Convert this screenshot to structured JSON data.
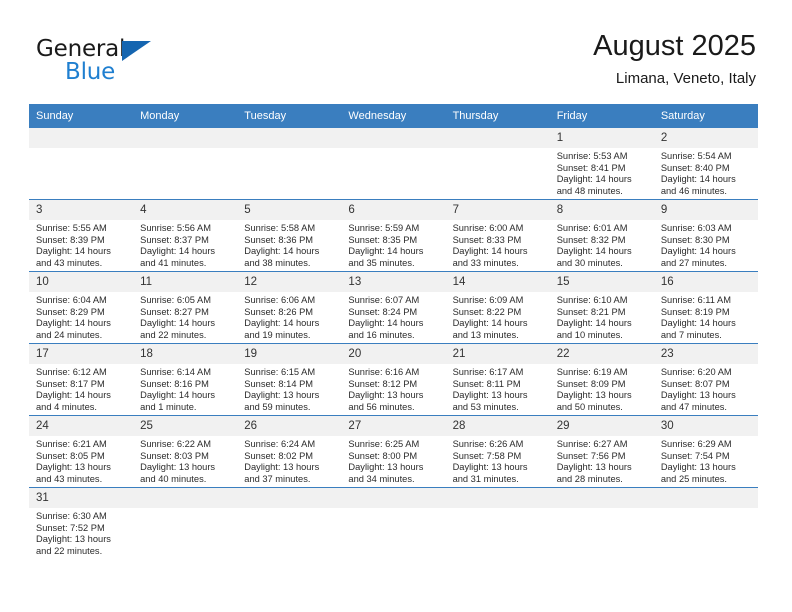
{
  "brand": {
    "name_top": "General",
    "name_bottom": "Blue",
    "triangle_icon": "triangle-icon",
    "color_dark": "#1a1a1a",
    "color_blue": "#1f7fd0"
  },
  "header": {
    "title": "August 2025",
    "subtitle": "Limana, Veneto, Italy"
  },
  "theme": {
    "header_blue": "#3a7ebf",
    "daynum_band": "#f1f1f1",
    "grid_line": "#3a7ebf",
    "text": "#2b2b2b"
  },
  "weekdays": [
    "Sunday",
    "Monday",
    "Tuesday",
    "Wednesday",
    "Thursday",
    "Friday",
    "Saturday"
  ],
  "weeks": [
    [
      {
        "day": "",
        "blank": true,
        "sunrise": "",
        "sunset": "",
        "daylight_1": "",
        "daylight_2": ""
      },
      {
        "day": "",
        "blank": true,
        "sunrise": "",
        "sunset": "",
        "daylight_1": "",
        "daylight_2": ""
      },
      {
        "day": "",
        "blank": true,
        "sunrise": "",
        "sunset": "",
        "daylight_1": "",
        "daylight_2": ""
      },
      {
        "day": "",
        "blank": true,
        "sunrise": "",
        "sunset": "",
        "daylight_1": "",
        "daylight_2": ""
      },
      {
        "day": "",
        "blank": true,
        "sunrise": "",
        "sunset": "",
        "daylight_1": "",
        "daylight_2": ""
      },
      {
        "day": "1",
        "blank": false,
        "sunrise": "Sunrise: 5:53 AM",
        "sunset": "Sunset: 8:41 PM",
        "daylight_1": "Daylight: 14 hours",
        "daylight_2": "and 48 minutes."
      },
      {
        "day": "2",
        "blank": false,
        "sunrise": "Sunrise: 5:54 AM",
        "sunset": "Sunset: 8:40 PM",
        "daylight_1": "Daylight: 14 hours",
        "daylight_2": "and 46 minutes."
      }
    ],
    [
      {
        "day": "3",
        "blank": false,
        "sunrise": "Sunrise: 5:55 AM",
        "sunset": "Sunset: 8:39 PM",
        "daylight_1": "Daylight: 14 hours",
        "daylight_2": "and 43 minutes."
      },
      {
        "day": "4",
        "blank": false,
        "sunrise": "Sunrise: 5:56 AM",
        "sunset": "Sunset: 8:37 PM",
        "daylight_1": "Daylight: 14 hours",
        "daylight_2": "and 41 minutes."
      },
      {
        "day": "5",
        "blank": false,
        "sunrise": "Sunrise: 5:58 AM",
        "sunset": "Sunset: 8:36 PM",
        "daylight_1": "Daylight: 14 hours",
        "daylight_2": "and 38 minutes."
      },
      {
        "day": "6",
        "blank": false,
        "sunrise": "Sunrise: 5:59 AM",
        "sunset": "Sunset: 8:35 PM",
        "daylight_1": "Daylight: 14 hours",
        "daylight_2": "and 35 minutes."
      },
      {
        "day": "7",
        "blank": false,
        "sunrise": "Sunrise: 6:00 AM",
        "sunset": "Sunset: 8:33 PM",
        "daylight_1": "Daylight: 14 hours",
        "daylight_2": "and 33 minutes."
      },
      {
        "day": "8",
        "blank": false,
        "sunrise": "Sunrise: 6:01 AM",
        "sunset": "Sunset: 8:32 PM",
        "daylight_1": "Daylight: 14 hours",
        "daylight_2": "and 30 minutes."
      },
      {
        "day": "9",
        "blank": false,
        "sunrise": "Sunrise: 6:03 AM",
        "sunset": "Sunset: 8:30 PM",
        "daylight_1": "Daylight: 14 hours",
        "daylight_2": "and 27 minutes."
      }
    ],
    [
      {
        "day": "10",
        "blank": false,
        "sunrise": "Sunrise: 6:04 AM",
        "sunset": "Sunset: 8:29 PM",
        "daylight_1": "Daylight: 14 hours",
        "daylight_2": "and 24 minutes."
      },
      {
        "day": "11",
        "blank": false,
        "sunrise": "Sunrise: 6:05 AM",
        "sunset": "Sunset: 8:27 PM",
        "daylight_1": "Daylight: 14 hours",
        "daylight_2": "and 22 minutes."
      },
      {
        "day": "12",
        "blank": false,
        "sunrise": "Sunrise: 6:06 AM",
        "sunset": "Sunset: 8:26 PM",
        "daylight_1": "Daylight: 14 hours",
        "daylight_2": "and 19 minutes."
      },
      {
        "day": "13",
        "blank": false,
        "sunrise": "Sunrise: 6:07 AM",
        "sunset": "Sunset: 8:24 PM",
        "daylight_1": "Daylight: 14 hours",
        "daylight_2": "and 16 minutes."
      },
      {
        "day": "14",
        "blank": false,
        "sunrise": "Sunrise: 6:09 AM",
        "sunset": "Sunset: 8:22 PM",
        "daylight_1": "Daylight: 14 hours",
        "daylight_2": "and 13 minutes."
      },
      {
        "day": "15",
        "blank": false,
        "sunrise": "Sunrise: 6:10 AM",
        "sunset": "Sunset: 8:21 PM",
        "daylight_1": "Daylight: 14 hours",
        "daylight_2": "and 10 minutes."
      },
      {
        "day": "16",
        "blank": false,
        "sunrise": "Sunrise: 6:11 AM",
        "sunset": "Sunset: 8:19 PM",
        "daylight_1": "Daylight: 14 hours",
        "daylight_2": "and 7 minutes."
      }
    ],
    [
      {
        "day": "17",
        "blank": false,
        "sunrise": "Sunrise: 6:12 AM",
        "sunset": "Sunset: 8:17 PM",
        "daylight_1": "Daylight: 14 hours",
        "daylight_2": "and 4 minutes."
      },
      {
        "day": "18",
        "blank": false,
        "sunrise": "Sunrise: 6:14 AM",
        "sunset": "Sunset: 8:16 PM",
        "daylight_1": "Daylight: 14 hours",
        "daylight_2": "and 1 minute."
      },
      {
        "day": "19",
        "blank": false,
        "sunrise": "Sunrise: 6:15 AM",
        "sunset": "Sunset: 8:14 PM",
        "daylight_1": "Daylight: 13 hours",
        "daylight_2": "and 59 minutes."
      },
      {
        "day": "20",
        "blank": false,
        "sunrise": "Sunrise: 6:16 AM",
        "sunset": "Sunset: 8:12 PM",
        "daylight_1": "Daylight: 13 hours",
        "daylight_2": "and 56 minutes."
      },
      {
        "day": "21",
        "blank": false,
        "sunrise": "Sunrise: 6:17 AM",
        "sunset": "Sunset: 8:11 PM",
        "daylight_1": "Daylight: 13 hours",
        "daylight_2": "and 53 minutes."
      },
      {
        "day": "22",
        "blank": false,
        "sunrise": "Sunrise: 6:19 AM",
        "sunset": "Sunset: 8:09 PM",
        "daylight_1": "Daylight: 13 hours",
        "daylight_2": "and 50 minutes."
      },
      {
        "day": "23",
        "blank": false,
        "sunrise": "Sunrise: 6:20 AM",
        "sunset": "Sunset: 8:07 PM",
        "daylight_1": "Daylight: 13 hours",
        "daylight_2": "and 47 minutes."
      }
    ],
    [
      {
        "day": "24",
        "blank": false,
        "sunrise": "Sunrise: 6:21 AM",
        "sunset": "Sunset: 8:05 PM",
        "daylight_1": "Daylight: 13 hours",
        "daylight_2": "and 43 minutes."
      },
      {
        "day": "25",
        "blank": false,
        "sunrise": "Sunrise: 6:22 AM",
        "sunset": "Sunset: 8:03 PM",
        "daylight_1": "Daylight: 13 hours",
        "daylight_2": "and 40 minutes."
      },
      {
        "day": "26",
        "blank": false,
        "sunrise": "Sunrise: 6:24 AM",
        "sunset": "Sunset: 8:02 PM",
        "daylight_1": "Daylight: 13 hours",
        "daylight_2": "and 37 minutes."
      },
      {
        "day": "27",
        "blank": false,
        "sunrise": "Sunrise: 6:25 AM",
        "sunset": "Sunset: 8:00 PM",
        "daylight_1": "Daylight: 13 hours",
        "daylight_2": "and 34 minutes."
      },
      {
        "day": "28",
        "blank": false,
        "sunrise": "Sunrise: 6:26 AM",
        "sunset": "Sunset: 7:58 PM",
        "daylight_1": "Daylight: 13 hours",
        "daylight_2": "and 31 minutes."
      },
      {
        "day": "29",
        "blank": false,
        "sunrise": "Sunrise: 6:27 AM",
        "sunset": "Sunset: 7:56 PM",
        "daylight_1": "Daylight: 13 hours",
        "daylight_2": "and 28 minutes."
      },
      {
        "day": "30",
        "blank": false,
        "sunrise": "Sunrise: 6:29 AM",
        "sunset": "Sunset: 7:54 PM",
        "daylight_1": "Daylight: 13 hours",
        "daylight_2": "and 25 minutes."
      }
    ],
    [
      {
        "day": "31",
        "blank": false,
        "sunrise": "Sunrise: 6:30 AM",
        "sunset": "Sunset: 7:52 PM",
        "daylight_1": "Daylight: 13 hours",
        "daylight_2": "and 22 minutes."
      },
      {
        "day": "",
        "blank": true,
        "sunrise": "",
        "sunset": "",
        "daylight_1": "",
        "daylight_2": ""
      },
      {
        "day": "",
        "blank": true,
        "sunrise": "",
        "sunset": "",
        "daylight_1": "",
        "daylight_2": ""
      },
      {
        "day": "",
        "blank": true,
        "sunrise": "",
        "sunset": "",
        "daylight_1": "",
        "daylight_2": ""
      },
      {
        "day": "",
        "blank": true,
        "sunrise": "",
        "sunset": "",
        "daylight_1": "",
        "daylight_2": ""
      },
      {
        "day": "",
        "blank": true,
        "sunrise": "",
        "sunset": "",
        "daylight_1": "",
        "daylight_2": ""
      },
      {
        "day": "",
        "blank": true,
        "sunrise": "",
        "sunset": "",
        "daylight_1": "",
        "daylight_2": ""
      }
    ]
  ]
}
